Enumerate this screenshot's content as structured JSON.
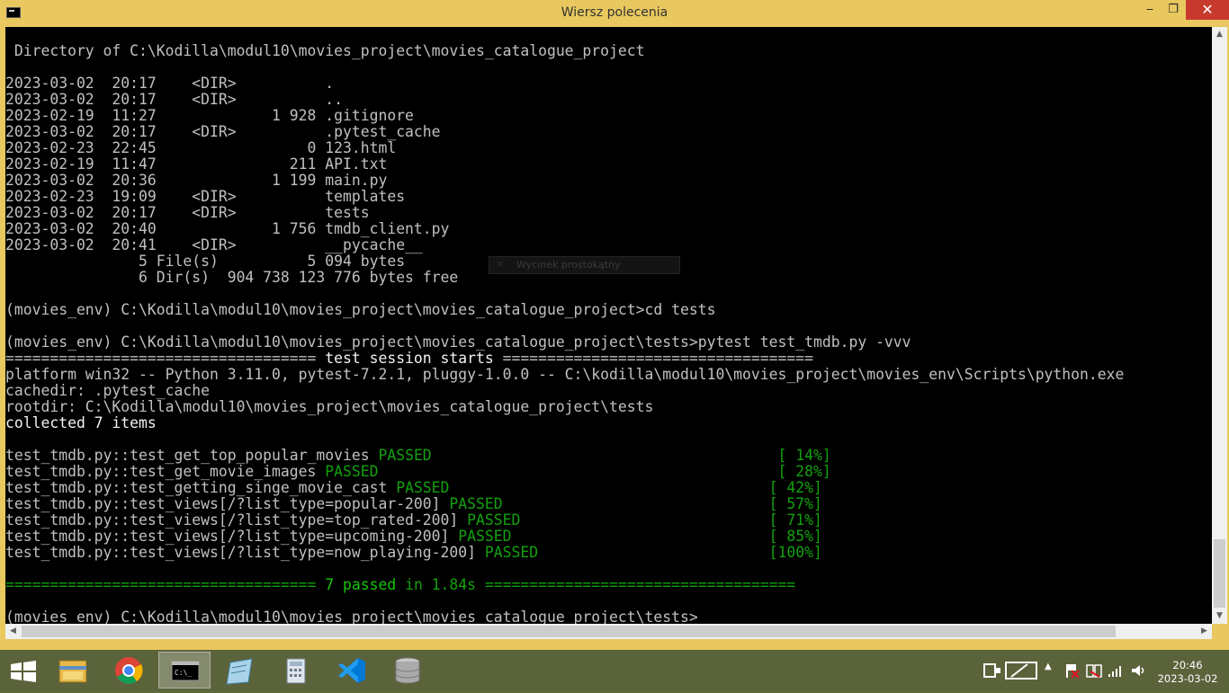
{
  "window": {
    "title": "Wiersz polecenia",
    "minimize": "‒",
    "maximize": "❐",
    "close": "✕"
  },
  "console_lines": [
    {
      "segs": [
        {
          "t": " Directory of C:\\Kodilla\\modul10\\movies_project\\movies_catalogue_project",
          "c": ""
        }
      ]
    },
    {
      "segs": [
        {
          "t": "",
          "c": ""
        }
      ]
    },
    {
      "segs": [
        {
          "t": "2023-03-02  20:17    <DIR>          .",
          "c": ""
        }
      ]
    },
    {
      "segs": [
        {
          "t": "2023-03-02  20:17    <DIR>          ..",
          "c": ""
        }
      ]
    },
    {
      "segs": [
        {
          "t": "2023-02-19  11:27             1 928 .gitignore",
          "c": ""
        }
      ]
    },
    {
      "segs": [
        {
          "t": "2023-03-02  20:17    <DIR>          .pytest_cache",
          "c": ""
        }
      ]
    },
    {
      "segs": [
        {
          "t": "2023-02-23  22:45                 0 123.html",
          "c": ""
        }
      ]
    },
    {
      "segs": [
        {
          "t": "2023-02-19  11:47               211 API.txt",
          "c": ""
        }
      ]
    },
    {
      "segs": [
        {
          "t": "2023-03-02  20:36             1 199 main.py",
          "c": ""
        }
      ]
    },
    {
      "segs": [
        {
          "t": "2023-02-23  19:09    <DIR>          templates",
          "c": ""
        }
      ]
    },
    {
      "segs": [
        {
          "t": "2023-03-02  20:17    <DIR>          tests",
          "c": ""
        }
      ]
    },
    {
      "segs": [
        {
          "t": "2023-03-02  20:40             1 756 tmdb_client.py",
          "c": ""
        }
      ]
    },
    {
      "segs": [
        {
          "t": "2023-03-02  20:41    <DIR>          __pycache__",
          "c": ""
        }
      ]
    },
    {
      "segs": [
        {
          "t": "               5 File(s)          5 094 bytes",
          "c": ""
        }
      ]
    },
    {
      "segs": [
        {
          "t": "               6 Dir(s)  904 738 123 776 bytes free",
          "c": ""
        }
      ]
    },
    {
      "segs": [
        {
          "t": "",
          "c": ""
        }
      ]
    },
    {
      "segs": [
        {
          "t": "(movies_env) C:\\Kodilla\\modul10\\movies_project\\movies_catalogue_project>cd tests",
          "c": ""
        }
      ]
    },
    {
      "segs": [
        {
          "t": "",
          "c": ""
        }
      ]
    },
    {
      "segs": [
        {
          "t": "(movies_env) C:\\Kodilla\\modul10\\movies_project\\movies_catalogue_project\\tests>pytest test_tmdb.py -vvv",
          "c": ""
        }
      ]
    },
    {
      "segs": [
        {
          "t": "=================================== ",
          "c": ""
        },
        {
          "t": "test session starts",
          "c": "bold"
        },
        {
          "t": " ===================================",
          "c": ""
        }
      ]
    },
    {
      "segs": [
        {
          "t": "platform win32 -- Python 3.11.0, pytest-7.2.1, pluggy-1.0.0 -- C:\\kodilla\\modul10\\movies_project\\movies_env\\Scripts\\python.exe",
          "c": ""
        }
      ]
    },
    {
      "segs": [
        {
          "t": "cachedir: .pytest_cache",
          "c": ""
        }
      ]
    },
    {
      "segs": [
        {
          "t": "rootdir: C:\\Kodilla\\modul10\\movies_project\\movies_catalogue_project\\tests",
          "c": ""
        }
      ]
    },
    {
      "segs": [
        {
          "t": "collected 7 items",
          "c": "bold"
        }
      ]
    },
    {
      "segs": [
        {
          "t": "",
          "c": ""
        }
      ]
    },
    {
      "segs": [
        {
          "t": "test_tmdb.py::test_get_top_popular_movies ",
          "c": ""
        },
        {
          "t": "PASSED",
          "c": "green"
        },
        {
          "t": "                                       ",
          "c": ""
        },
        {
          "t": "[ 14%]",
          "c": "green"
        }
      ]
    },
    {
      "segs": [
        {
          "t": "test_tmdb.py::test_get_movie_images ",
          "c": ""
        },
        {
          "t": "PASSED",
          "c": "green"
        },
        {
          "t": "                                             ",
          "c": ""
        },
        {
          "t": "[ 28%]",
          "c": "green"
        }
      ]
    },
    {
      "segs": [
        {
          "t": "test_tmdb.py::test_getting_singe_movie_cast ",
          "c": ""
        },
        {
          "t": "PASSED",
          "c": "green"
        },
        {
          "t": "                                    ",
          "c": ""
        },
        {
          "t": "[ 42%]",
          "c": "green"
        }
      ]
    },
    {
      "segs": [
        {
          "t": "test_tmdb.py::test_views[/?list_type=popular-200] ",
          "c": ""
        },
        {
          "t": "PASSED",
          "c": "green"
        },
        {
          "t": "                              ",
          "c": ""
        },
        {
          "t": "[ 57%]",
          "c": "green"
        }
      ]
    },
    {
      "segs": [
        {
          "t": "test_tmdb.py::test_views[/?list_type=top_rated-200] ",
          "c": ""
        },
        {
          "t": "PASSED",
          "c": "green"
        },
        {
          "t": "                            ",
          "c": ""
        },
        {
          "t": "[ 71%]",
          "c": "green"
        }
      ]
    },
    {
      "segs": [
        {
          "t": "test_tmdb.py::test_views[/?list_type=upcoming-200] ",
          "c": ""
        },
        {
          "t": "PASSED",
          "c": "green"
        },
        {
          "t": "                             ",
          "c": ""
        },
        {
          "t": "[ 85%]",
          "c": "green"
        }
      ]
    },
    {
      "segs": [
        {
          "t": "test_tmdb.py::test_views[/?list_type=now_playing-200] ",
          "c": ""
        },
        {
          "t": "PASSED",
          "c": "green"
        },
        {
          "t": "                          ",
          "c": ""
        },
        {
          "t": "[100%]",
          "c": "green"
        }
      ]
    },
    {
      "segs": [
        {
          "t": "",
          "c": ""
        }
      ]
    },
    {
      "segs": [
        {
          "t": "=================================== ",
          "c": "green"
        },
        {
          "t": "7 passed",
          "c": "bgreen"
        },
        {
          "t": " in 1.84s",
          "c": "green"
        },
        {
          "t": " ===================================",
          "c": "green"
        }
      ]
    },
    {
      "segs": [
        {
          "t": "",
          "c": ""
        }
      ]
    },
    {
      "segs": [
        {
          "t": "(movies_env) C:\\Kodilla\\modul10\\movies_project\\movies_catalogue_project\\tests>",
          "c": ""
        }
      ]
    }
  ],
  "overlay": {
    "label": "Wycinek prostokątny",
    "icon": "scissors-icon"
  },
  "taskbar": {
    "items": [
      {
        "name": "start-button",
        "icon": "windows-logo-icon"
      },
      {
        "name": "file-explorer-button",
        "icon": "folder-icon"
      },
      {
        "name": "chrome-button",
        "icon": "chrome-icon"
      },
      {
        "name": "cmd-button",
        "icon": "cmd-icon",
        "active": true
      },
      {
        "name": "notepad-button",
        "icon": "notepad-icon"
      },
      {
        "name": "calculator-button",
        "icon": "calculator-icon"
      },
      {
        "name": "vscode-button",
        "icon": "vscode-icon"
      },
      {
        "name": "database-button",
        "icon": "database-icon"
      }
    ],
    "clock_time": "20:46",
    "clock_date": "2023-03-02"
  },
  "colors": {
    "titlebar": "#e8c85f",
    "close": "#c7392d",
    "console_bg": "#000000",
    "console_fg": "#c0c0c0",
    "pass_green": "#13a10e"
  }
}
